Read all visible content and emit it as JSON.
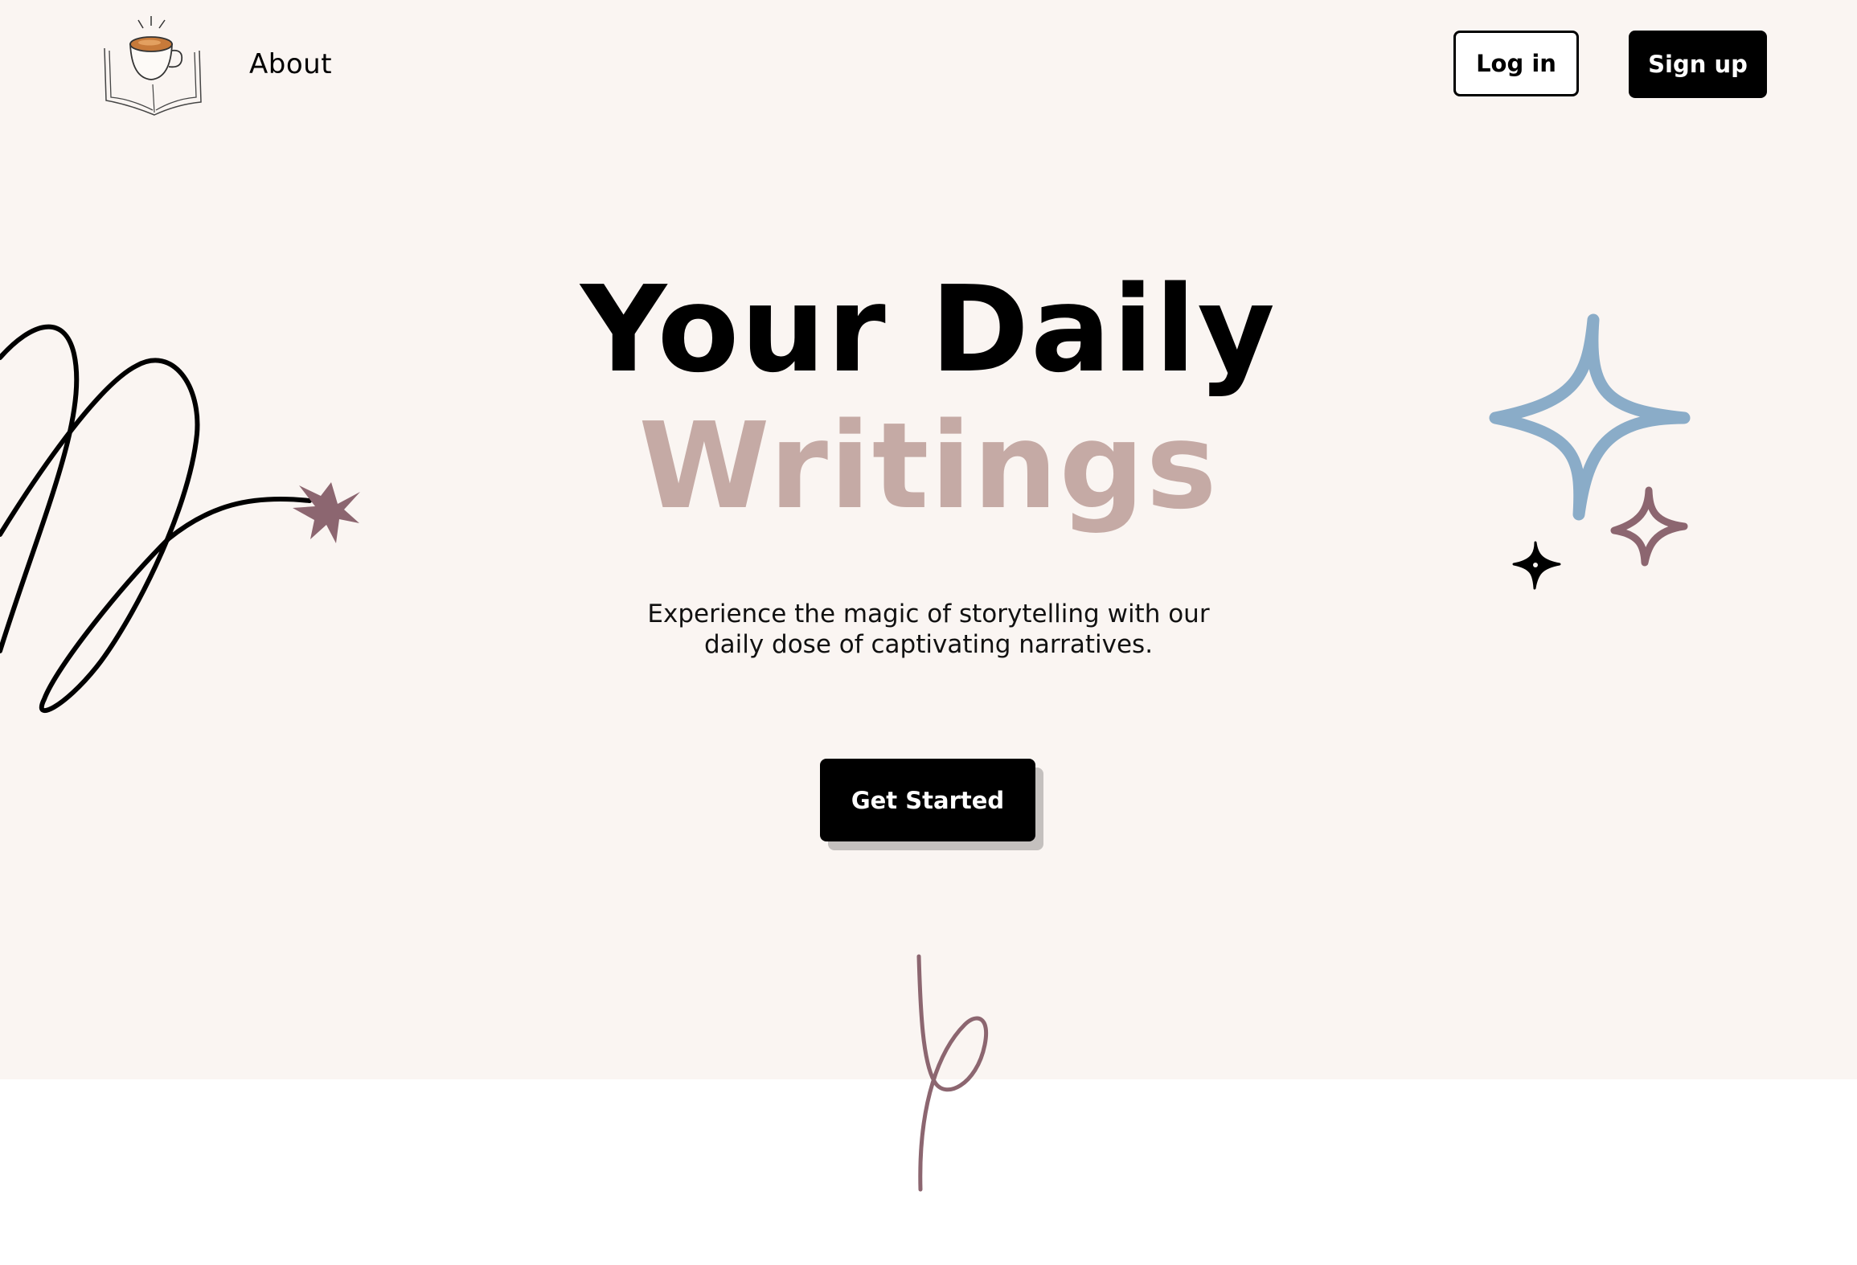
{
  "nav": {
    "about_label": "About",
    "login_label": "Log in",
    "signup_label": "Sign up"
  },
  "hero": {
    "title_line1": "Your Daily",
    "title_line2": "Writings",
    "subtitle_line1": "Experience the magic of storytelling with our",
    "subtitle_line2": "daily dose of captivating narratives.",
    "cta_label": "Get Started"
  },
  "colors": {
    "hero_background": "#faf5f2",
    "accent_pink": "#c5aaa5",
    "accent_mauve": "#8c6670",
    "accent_blue": "#8aacc8",
    "primary_black": "#000000"
  },
  "icons": {
    "logo": "coffee-book-icon",
    "sparkles": "sparkle-icon",
    "burst": "star-burst-icon"
  }
}
